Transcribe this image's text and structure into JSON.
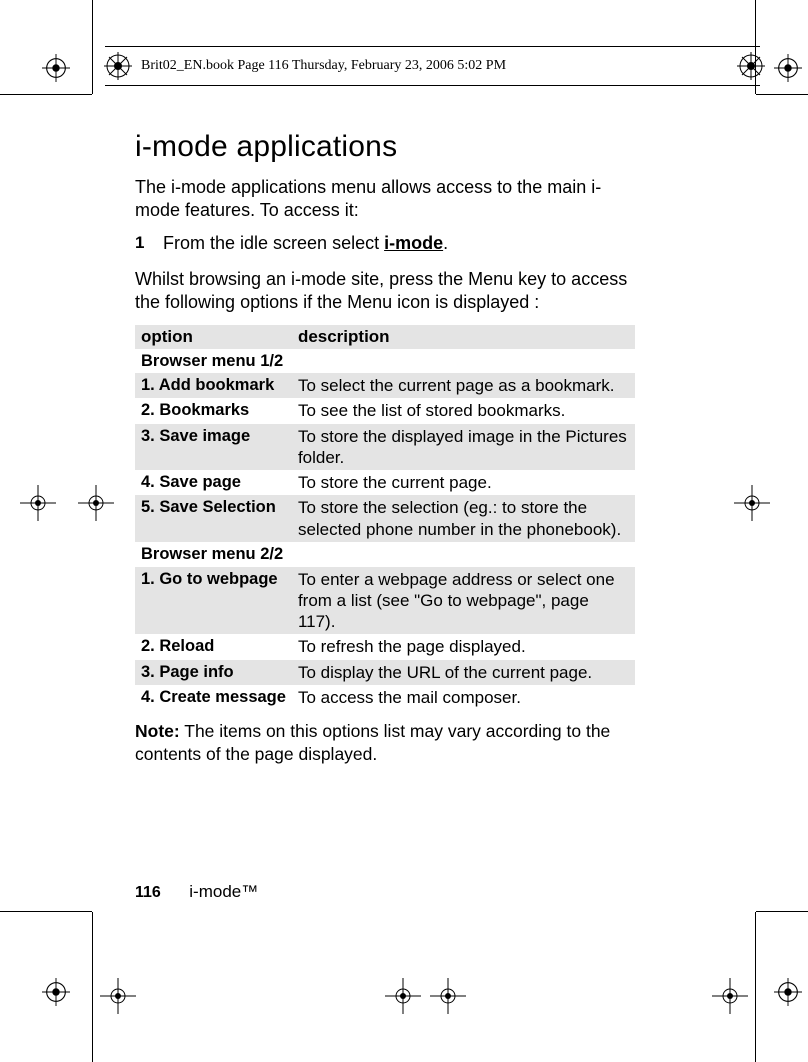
{
  "header": "Brit02_EN.book  Page 116  Thursday, February 23, 2006  5:02 PM",
  "title": "i-mode applications",
  "intro": "The i-mode applications menu allows access to the main i-mode features. To access it:",
  "step": {
    "num": "1",
    "prefix": "From the idle screen select ",
    "keyword": "i-mode",
    "suffix": "."
  },
  "intro2": "Whilst browsing an i-mode site, press the Menu key to access the following options if the Menu icon is displayed :",
  "table": {
    "col1": "option",
    "col2": "description",
    "section1": "Browser menu 1/2",
    "rows1": [
      {
        "opt": "1. Add bookmark",
        "desc": "To select the current page as a bookmark."
      },
      {
        "opt": "2. Bookmarks",
        "desc": "To see the list of stored bookmarks."
      },
      {
        "opt": "3. Save image",
        "desc": "To store the displayed image in the Pictures folder."
      },
      {
        "opt": "4. Save page",
        "desc": "To store the current page."
      },
      {
        "opt": "5. Save Selection",
        "desc": "To store the selection (eg.: to store the selected phone number in the phonebook)."
      }
    ],
    "section2": "Browser menu 2/2",
    "rows2": [
      {
        "opt": "1. Go to webpage",
        "desc": "To enter a webpage address or select one from a list (see \"Go to webpage\", page 117)."
      },
      {
        "opt": "2. Reload",
        "desc": "To refresh the page displayed."
      },
      {
        "opt": "3. Page info",
        "desc": "To display the URL of the current page."
      },
      {
        "opt": "4. Create message",
        "desc": "To access the mail composer."
      }
    ]
  },
  "note": {
    "label": "Note:",
    "text": " The items on this options list may vary according to the contents of the page displayed."
  },
  "footer": {
    "page": "116",
    "chapter": "i-mode™"
  }
}
